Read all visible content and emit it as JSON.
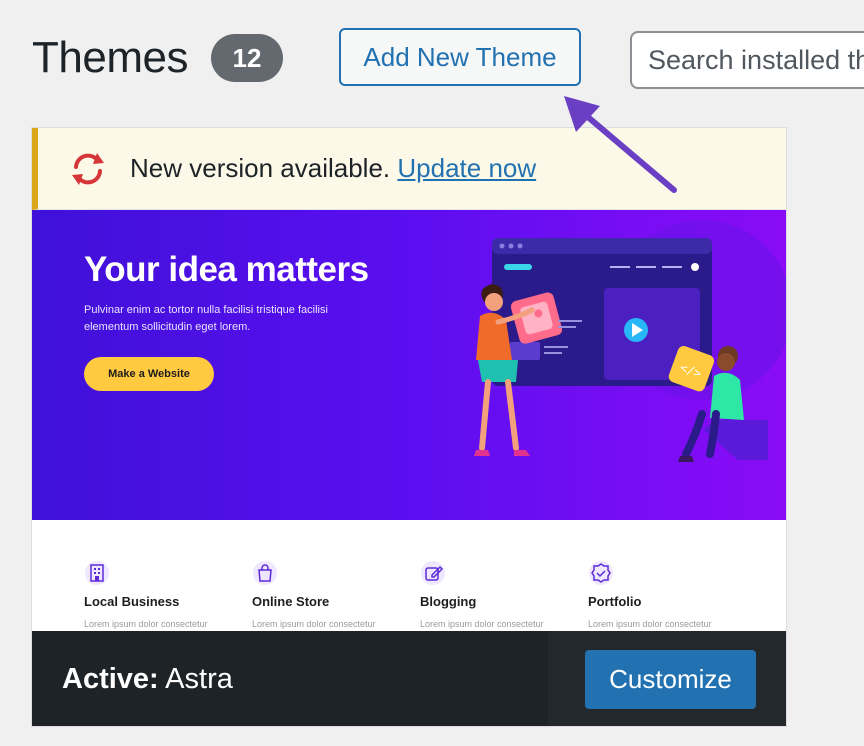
{
  "header": {
    "title": "Themes",
    "count": "12",
    "add_button": "Add New Theme",
    "search_placeholder": "Search installed themes..."
  },
  "notice": {
    "text": "New version available.",
    "link": "Update now",
    "icon": "update-icon"
  },
  "preview": {
    "hero_title": "Your idea matters",
    "hero_text": "Pulvinar enim ac tortor nulla facilisi tristique facilisi elementum sollicitudin eget lorem.",
    "hero_button": "Make a Website",
    "features": [
      {
        "label": "Local Business",
        "icon": "building-icon",
        "desc": "Lorem ipsum dolor consectetur"
      },
      {
        "label": "Online Store",
        "icon": "shopping-bag-icon",
        "desc": "Lorem ipsum dolor consectetur"
      },
      {
        "label": "Blogging",
        "icon": "edit-icon",
        "desc": "Lorem ipsum dolor consectetur"
      },
      {
        "label": "Portfolio",
        "icon": "badge-check-icon",
        "desc": "Lorem ipsum dolor consectetur"
      }
    ]
  },
  "footer": {
    "active_prefix": "Active:",
    "theme_name": "Astra",
    "customize_button": "Customize"
  },
  "colors": {
    "accent": "#2271b1",
    "hero_start": "#3f11d8",
    "hero_end": "#8a0cf6",
    "cta": "#ffc940",
    "notice_border": "#dba617",
    "arrow": "#6b3fc4"
  }
}
